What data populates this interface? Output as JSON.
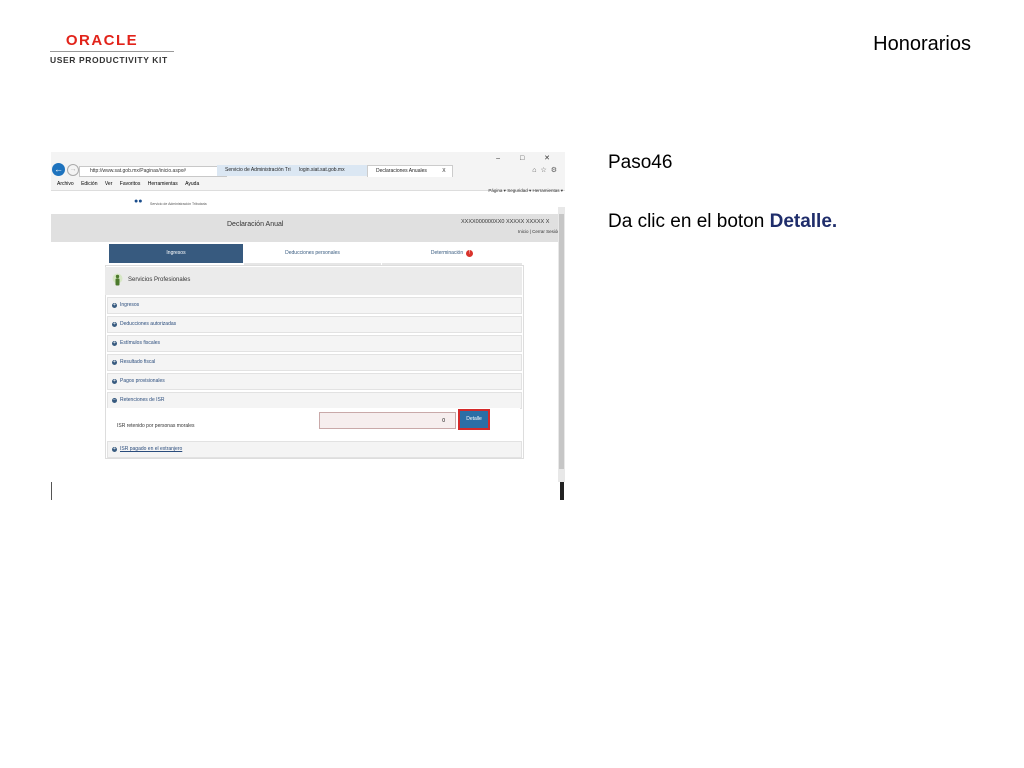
{
  "slide": {
    "title": "Honorarios",
    "step_label": "Paso46",
    "instruction_prefix": "Da clic en el boton ",
    "instruction_bold": "Detalle."
  },
  "logo": {
    "brand": "ORACLE",
    "subtitle": "USER PRODUCTIVITY KIT"
  },
  "browser": {
    "url": "http://www.sat.gob.mx/Paginas/inicio.aspx#",
    "tabs": [
      "Servicio de Administración Tri...",
      "login.siat.sat.gob.mx",
      "Declaraciones Anuales"
    ],
    "tab_close": "X",
    "menu": [
      "Archivo",
      "Edición",
      "Ver",
      "Favoritos",
      "Herramientas",
      "Ayuda"
    ],
    "command_bar": "Página ▾   Seguridad ▾   Herramientas ▾"
  },
  "site": {
    "agency": "Servicio de Administración Tributaria",
    "page_title": "Declaración Anual",
    "rfc": "XXXX000000XX0  XXXXX XXXXX X",
    "header_links": "Inicio | Cerrar Sesión",
    "steps": [
      {
        "label": "Ingresos"
      },
      {
        "label": "Deducciones personales"
      },
      {
        "label": "Determinación",
        "badge": "!"
      }
    ],
    "panel_title": "Servicios Profesionales",
    "sections": [
      "Ingresos",
      "Deducciones autorizadas",
      "Estímulos fiscales",
      "Resultado fiscal",
      "Pagos provisionales",
      "Retenciones de ISR"
    ],
    "retention_label": "ISR retenido por personas morales",
    "retention_value": "0",
    "detalle_label": "Detalle",
    "foreign_section": "ISR pagado en el extranjero"
  }
}
